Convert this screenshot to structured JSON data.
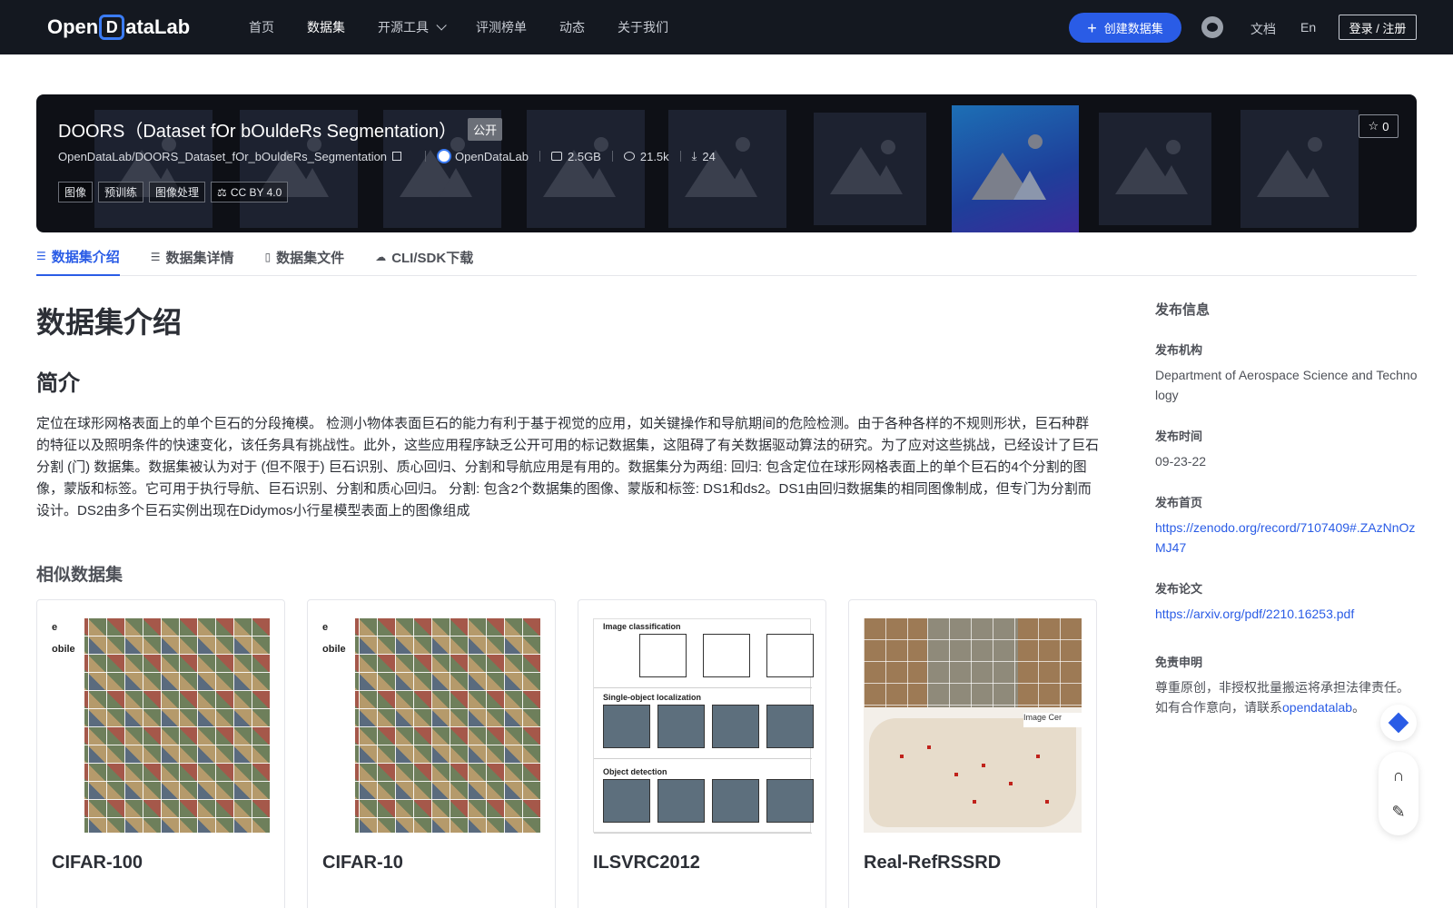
{
  "nav": {
    "logo_pre": "Open",
    "logo_mark": "D",
    "logo_post": "ataLab",
    "links": [
      {
        "label": "首页"
      },
      {
        "label": "数据集",
        "active": true
      },
      {
        "label": "开源工具",
        "has_dropdown": true
      },
      {
        "label": "评测榜单"
      },
      {
        "label": "动态"
      },
      {
        "label": "关于我们"
      }
    ],
    "create_label": "创建数据集",
    "docs_label": "文档",
    "lang_label": "En",
    "login_label": "登录 / 注册"
  },
  "banner": {
    "title": "DOORS（Dataset fOr bOuldeRs Segmentation）",
    "public_tag": "公开",
    "repo_path": "OpenDataLab/DOORS_Dataset_fOr_bOuldeRs_Segmentation",
    "org": "OpenDataLab",
    "size": "2.5GB",
    "views": "21.5k",
    "downloads": "24",
    "tags": [
      "图像",
      "预训练",
      "图像处理"
    ],
    "license": "CC BY 4.0",
    "stars": "0"
  },
  "tabs": [
    {
      "label": "数据集介绍",
      "icon": "database-icon",
      "active": true
    },
    {
      "label": "数据集详情",
      "icon": "list-icon"
    },
    {
      "label": "数据集文件",
      "icon": "file-icon"
    },
    {
      "label": "CLI/SDK下载",
      "icon": "cloud-download-icon"
    }
  ],
  "main": {
    "title": "数据集介绍",
    "section_title": "简介",
    "description": "定位在球形网格表面上的单个巨石的分段掩模。 检测小物体表面巨石的能力有利于基于视觉的应用，如关键操作和导航期间的危险检测。由于各种各样的不规则形状，巨石种群的特征以及照明条件的快速变化，该任务具有挑战性。此外，这些应用程序缺乏公开可用的标记数据集，这阻碍了有关数据驱动算法的研究。为了应对这些挑战，已经设计了巨石分割 (门) 数据集。数据集被认为对于 (但不限于) 巨石识别、质心回归、分割和导航应用是有用的。数据集分为两组: 回归: 包含定位在球形网格表面上的单个巨石的4个分割的图像，蒙版和标签。它可用于执行导航、巨石识别、分割和质心回归。 分割: 包含2个数据集的图像、蒙版和标签: DS1和ds2。DS1由回归数据集的相同图像制成，但专门为分割而设计。DS2由多个巨石实例出现在Didymos小行星模型表面上的图像组成",
    "similar_title": "相似数据集",
    "similar": [
      {
        "name": "CIFAR-100",
        "side_labels": [
          "e",
          "obile"
        ]
      },
      {
        "name": "CIFAR-10",
        "side_labels": [
          "e",
          "obile"
        ]
      },
      {
        "name": "ILSVRC2012",
        "rows": [
          "Image classification",
          "Single-object localization",
          "Object detection"
        ]
      },
      {
        "name": "Real-RefRSSRD",
        "legend": "Image Cer"
      }
    ]
  },
  "info": {
    "heading": "发布信息",
    "org_label": "发布机构",
    "org_value": "Department of Aerospace Science and Technology",
    "time_label": "发布时间",
    "time_value": "09-23-22",
    "homepage_label": "发布首页",
    "homepage_value": "https://zenodo.org/record/7107409#.ZAzNnOzMJ47",
    "paper_label": "发布论文",
    "paper_value": "https://arxiv.org/pdf/2210.16253.pdf",
    "disclaimer_label": "免责申明",
    "disclaimer_text": "尊重原创，非授权批量搬运将承担法律责任。如有合作意向，请联系",
    "disclaimer_link": "opendatalab",
    "disclaimer_end": "。"
  },
  "colors": {
    "accent": "#2a5ce6",
    "nav_bg": "#141820",
    "banner_bg": "#0e1016"
  }
}
